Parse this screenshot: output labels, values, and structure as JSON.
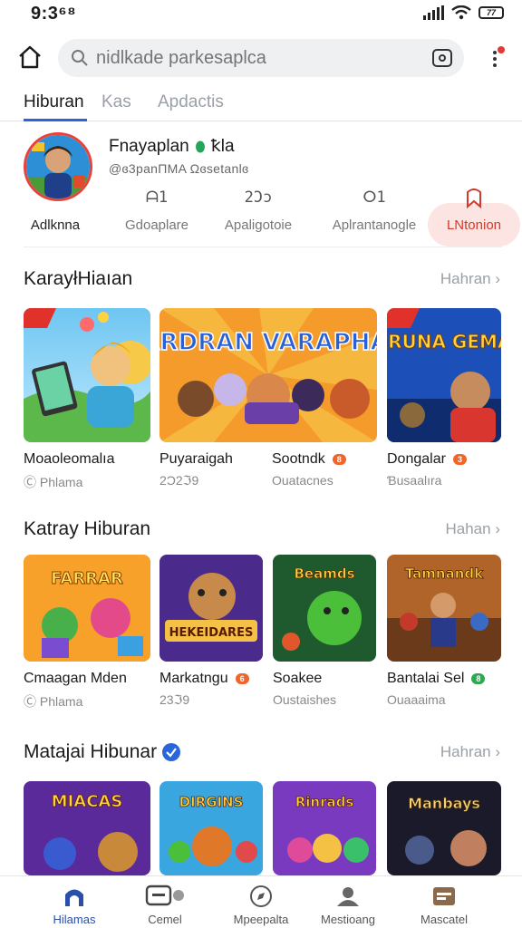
{
  "status": {
    "time": "9:3⁶⁸",
    "battery": "77"
  },
  "search": {
    "placeholder": "nidlkade parkesaplca"
  },
  "tabs": [
    {
      "label": "Hiburan",
      "active": true
    },
    {
      "label": "Kas",
      "active": false
    },
    {
      "label": "Apdactis",
      "active": false
    }
  ],
  "profile": {
    "name": "Fnayaplan",
    "name_suffix": "ꝁla",
    "subtitle": "@ɞ3panΠMA Ωɞsetanlɞ",
    "stats": [
      {
        "icon": "",
        "label": "Adlknna"
      },
      {
        "icon": "ᗩ1",
        "label": "Gdoaplare"
      },
      {
        "icon": "2Ɔɔ",
        "label": "Apaligotoie"
      },
      {
        "icon": "ⵔ1",
        "label": "Aplrantanogle"
      },
      {
        "icon": "",
        "label": "LNtonion"
      }
    ]
  },
  "sections": [
    {
      "title": "KarayłHiaıan",
      "more": "Hahran",
      "cards": [
        {
          "name": "Moaoleomalıa",
          "sub": "Ⓒ Phlama",
          "badge": "",
          "art_text": ""
        },
        {
          "name": "Puyaraigah",
          "sub": "2Ɔ2ℑ9",
          "badge": "",
          "art_text": "FARDRAN VARAPHAN"
        },
        {
          "name": "Sootndk",
          "sub": "Ouatacnes",
          "badge": "8",
          "art_text": ""
        },
        {
          "name": "Dongalar",
          "sub": "Ɓusaalıra",
          "badge": "3",
          "art_text": "FARUNA GEMAS"
        }
      ]
    },
    {
      "title": "Katray Hiburan",
      "more": "Hahan",
      "cards": [
        {
          "name": "Cmaagan Mden",
          "sub": "Ⓒ Phlama",
          "badge": "",
          "art_text": "FARRAR"
        },
        {
          "name": "Markatngu",
          "sub": "23ℑ9",
          "badge": "6",
          "art_text": "HEKEIDARES"
        },
        {
          "name": "Soakee",
          "sub": "Oustaishes",
          "badge": "",
          "art_text": "Beamds"
        },
        {
          "name": "Bantalai Sel",
          "sub": "Ouaaaima",
          "badge": "8",
          "art_text": "Tamnandk"
        }
      ]
    },
    {
      "title": "Matajai Hibunar",
      "more": "Hahran",
      "cards": [
        {
          "name": "",
          "sub": "",
          "badge": "",
          "art_text": "MIACAS"
        },
        {
          "name": "",
          "sub": "",
          "badge": "",
          "art_text": "DIRGINS"
        },
        {
          "name": "",
          "sub": "",
          "badge": "",
          "art_text": "Rinrads"
        },
        {
          "name": "",
          "sub": "",
          "badge": "",
          "art_text": "Manbays"
        }
      ]
    }
  ],
  "bottom_nav": [
    {
      "label": "Hilamas",
      "icon": "home-icon",
      "active": true
    },
    {
      "label": "Cemel",
      "icon": "chat-icon",
      "active": false
    },
    {
      "label": "Mpeepalta",
      "icon": "compass-icon",
      "active": false
    },
    {
      "label": "Mestioang",
      "icon": "person-icon",
      "active": false
    },
    {
      "label": "Mascatel",
      "icon": "message-icon",
      "active": false
    }
  ],
  "colors": {
    "accent": "#2a66d9",
    "highlight": "#d23a2b",
    "highlight_bg": "#fbe4e1"
  }
}
